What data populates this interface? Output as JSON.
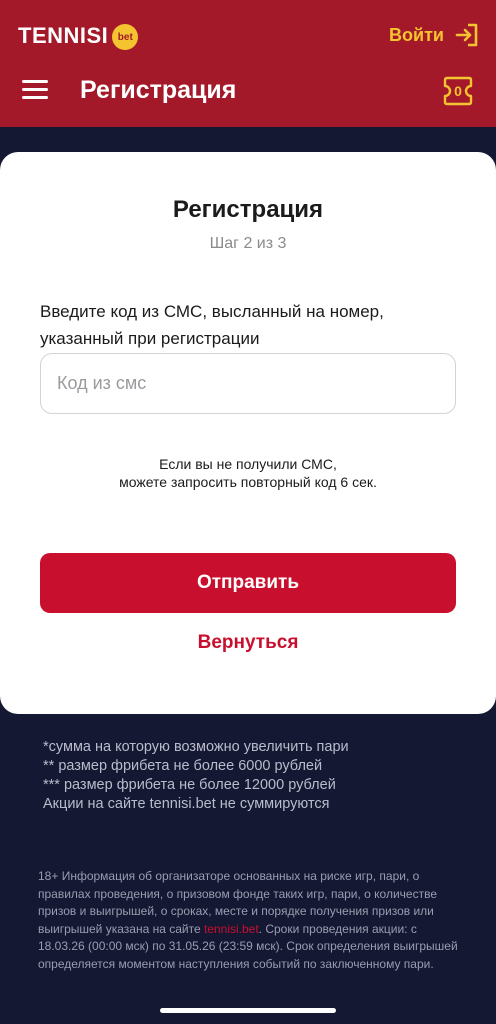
{
  "header": {
    "logo_text": "TENNISI",
    "logo_badge": "bet",
    "login_label": "Войти",
    "page_title": "Регистрация",
    "coupon_count": "0",
    "colors": {
      "brand_red": "#a3192a",
      "accent_yellow": "#f4c430"
    },
    "icons": {
      "menu": "hamburger-menu-icon",
      "login": "login-arrow-icon",
      "coupon": "bet-coupon-icon"
    }
  },
  "card": {
    "title": "Регистрация",
    "step": "Шаг 2 из 3",
    "prompt": "Введите код из СМС, высланный на номер, указанный при регистрации",
    "sms_placeholder": "Код из смс",
    "sms_value": "",
    "resend_line1": "Если вы не получили СМС,",
    "resend_line2": "можете запросить повторный код 6 сек.",
    "submit_label": "Отправить",
    "back_label": "Вернуться",
    "colors": {
      "button_red": "#c8102e"
    }
  },
  "notes": [
    "*сумма на которую возможно увеличить пари",
    "** размер фрибета не более 6000 рублей",
    "*** размер фрибета не более 12000 рублей",
    "Акции на сайте tennisi.bet не суммируются"
  ],
  "legal": {
    "text_before_link": "18+  Информация об организаторе основанных на риске игр, пари, о правилах проведения, о призовом фонде таких игр, пари, о количестве призов и выигрышей, о сроках, месте и порядке получения призов или выигрышей указана на сайте ",
    "link": "tennisi.bet",
    "text_after_link": ". Сроки проведения акции: с 18.03.26 (00:00 мск) по 31.05.26 (23:59 мск). Срок определения выигрышей определяется моментом наступления событий по заключенному пари."
  }
}
